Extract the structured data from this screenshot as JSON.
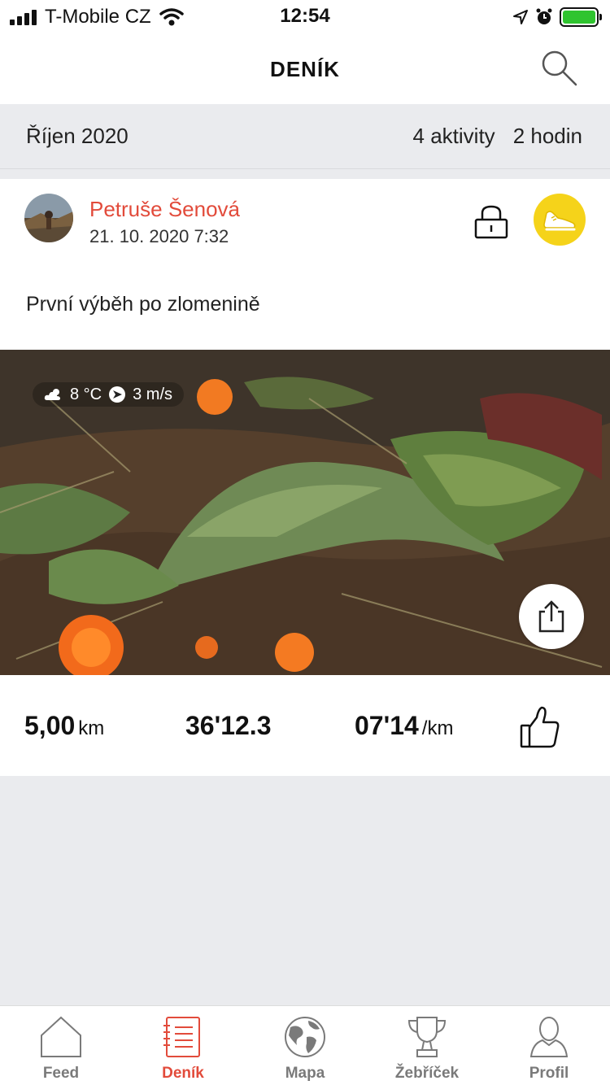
{
  "status_bar": {
    "carrier": "T-Mobile CZ",
    "time": "12:54"
  },
  "nav": {
    "title": "DENÍK"
  },
  "summary": {
    "month": "Říjen 2020",
    "activities": "4 aktivity",
    "hours": "2 hodin"
  },
  "activity": {
    "author": "Petruše Šenová",
    "date": "21. 10. 2020 7:32",
    "description": "První výběh po zlomenině",
    "weather": {
      "temperature": "8 °C",
      "wind": "3 m/s"
    },
    "stats": {
      "distance_value": "5,00",
      "distance_unit": "km",
      "duration": "36'12.3",
      "pace_value": "07'14",
      "pace_unit": "/km"
    }
  },
  "tabs": [
    {
      "label": "Feed",
      "icon": "home-icon"
    },
    {
      "label": "Deník",
      "icon": "diary-icon"
    },
    {
      "label": "Mapa",
      "icon": "globe-icon"
    },
    {
      "label": "Žebříček",
      "icon": "trophy-icon"
    },
    {
      "label": "Profil",
      "icon": "profile-icon"
    }
  ],
  "colors": {
    "accent": "#e24b3b",
    "sport_badge": "#f5d31a",
    "tab_inactive": "#7a7a7a",
    "background": "#eaebee"
  }
}
